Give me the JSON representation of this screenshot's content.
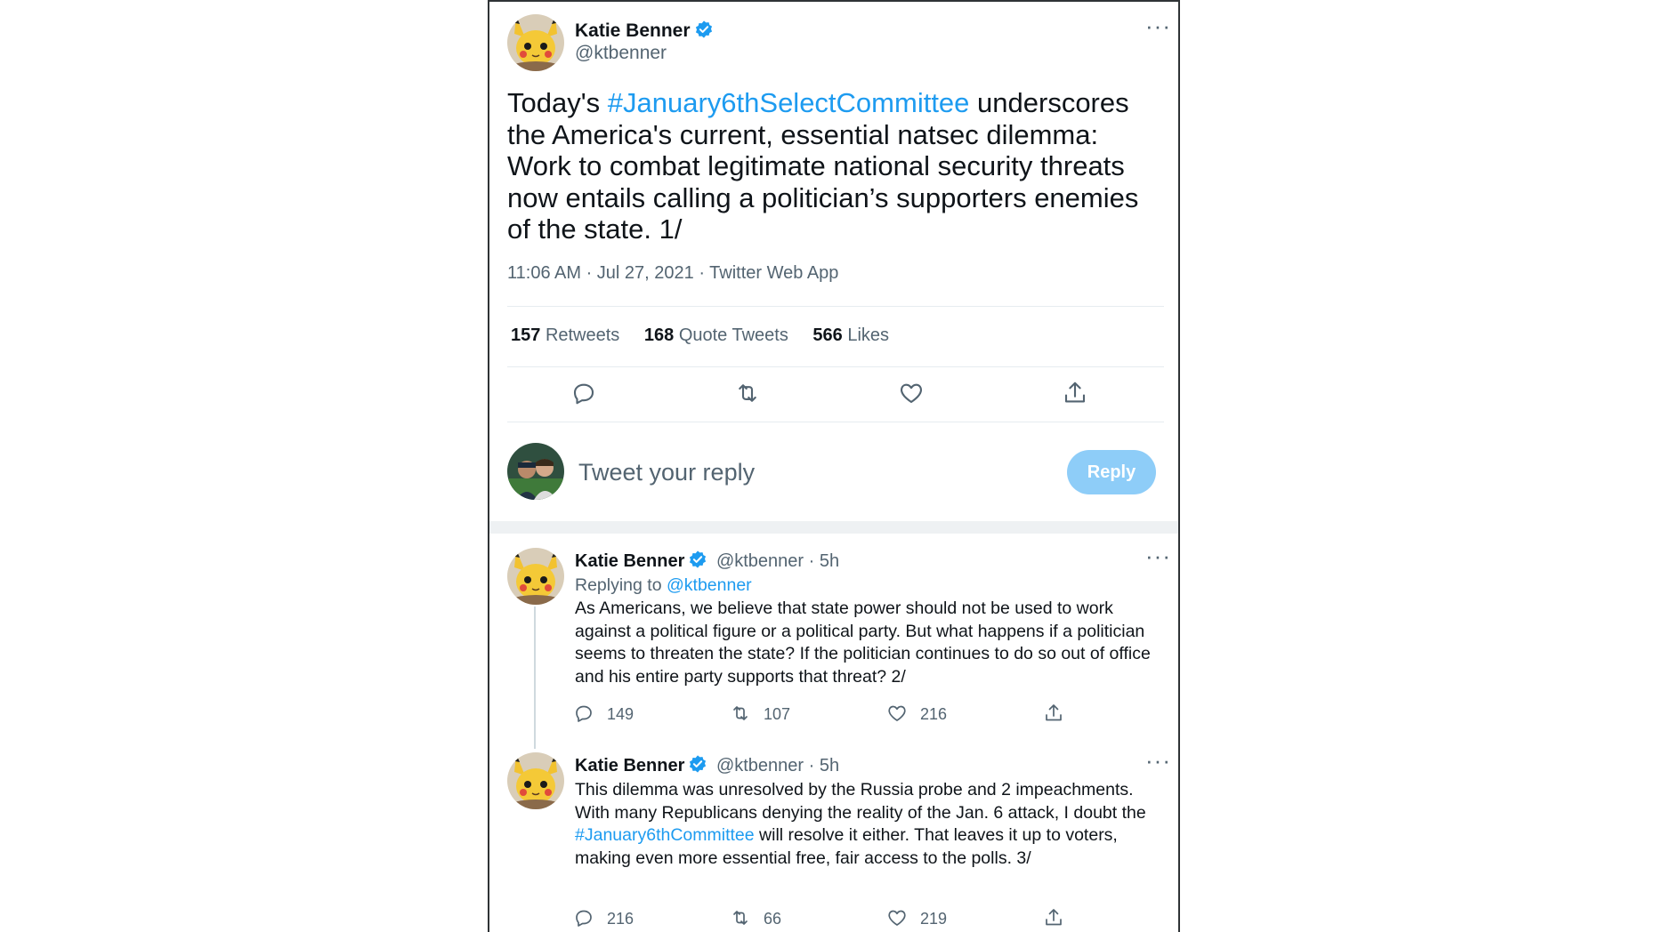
{
  "main_tweet": {
    "name": "Katie Benner",
    "handle": "@ktbenner",
    "text_pre": "Today's ",
    "hashtag": "#January6thSelectCommittee",
    "text_post": " underscores the America's current, essential natsec dilemma: Work to combat legitimate national security threats now entails calling a politician’s supporters enemies of the state. 1/",
    "timestamp": "11:06 AM · Jul 27, 2021 · Twitter Web App",
    "stats": {
      "retweets_count": "157",
      "retweets_label": "Retweets",
      "quotes_count": "168",
      "quotes_label": "Quote Tweets",
      "likes_count": "566",
      "likes_label": "Likes"
    },
    "actions": [
      "reply-icon",
      "retweet-icon",
      "like-icon",
      "share-icon"
    ]
  },
  "reply_box": {
    "placeholder": "Tweet your reply",
    "button_label": "Reply"
  },
  "thread": [
    {
      "name": "Katie Benner",
      "handle_time": "@ktbenner · 5h",
      "replying_prefix": "Replying to ",
      "replying_handle": "@ktbenner",
      "text": "As Americans, we believe that state power should not be used to work against a political figure or a political party. But what happens if a politician seems to threaten the state? If the politician continues to do so out of office and his entire party supports that threat? 2/",
      "replies": "149",
      "retweets": "107",
      "likes": "216"
    },
    {
      "name": "Katie Benner",
      "handle_time": "@ktbenner · 5h",
      "text_pre": "This dilemma was unresolved by the Russia probe and 2 impeachments. With many Republicans denying the reality of the Jan. 6 attack, I doubt the ",
      "hashtag": "#January6thCommittee",
      "text_post": " will resolve it either. That leaves it up to voters, making even more essential free, fair access to the polls. 3/",
      "replies": "216",
      "retweets": "66",
      "likes": "219"
    }
  ],
  "colors": {
    "link": "#1d9bf0",
    "reply_button": "#8ecdf8",
    "secondary_text": "#536471"
  }
}
